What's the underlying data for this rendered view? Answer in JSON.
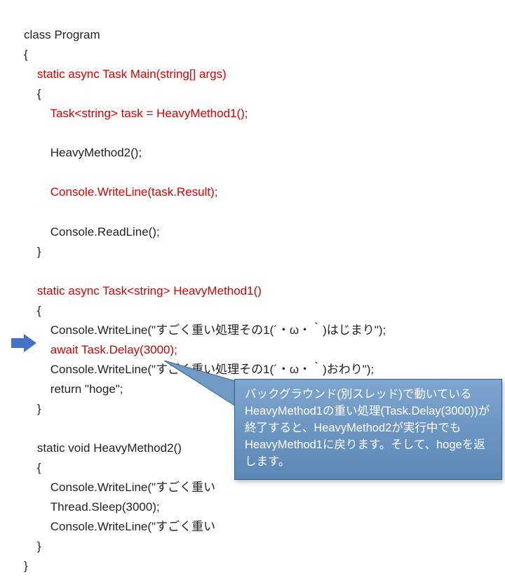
{
  "code": {
    "l1": "class Program",
    "l2": "{",
    "l3": "    static async Task Main(string[] args)",
    "l4": "    {",
    "l5": "        Task<string> task = HeavyMethod1();",
    "l6": "",
    "l7": "        HeavyMethod2();",
    "l8": "",
    "l9": "        Console.WriteLine(task.Result);",
    "l10": "",
    "l11": "        Console.ReadLine();",
    "l12": "    }",
    "l13": "",
    "l14": "    static async Task<string> HeavyMethod1()",
    "l15": "    {",
    "l16": "        Console.WriteLine(\"すごく重い処理その1(´・ω・｀)はじまり\");",
    "l17": "        await Task.Delay(3000);",
    "l18": "        Console.WriteLine(\"すごく重い処理その1(´・ω・｀)おわり\");",
    "l19": "        return \"hoge\";",
    "l20": "    }",
    "l21": "",
    "l22": "    static void HeavyMethod2()",
    "l23": "    {",
    "l24a": "        Console.WriteLine(\"すごく重い",
    "l25": "        Thread.Sleep(3000);",
    "l26a": "        Console.WriteLine(\"すごく重い",
    "l27": "    }",
    "l28": "}"
  },
  "callout": {
    "text": "バックグラウンド(別スレッド)で動いているHeavyMethod1の重い処理(Task.Delay(3000))が終了すると、HeavyMethod2が実行中でもHeavyMethod1に戻ります。そして、hogeを返します。"
  },
  "arrow": {
    "color": "#4472c4"
  }
}
